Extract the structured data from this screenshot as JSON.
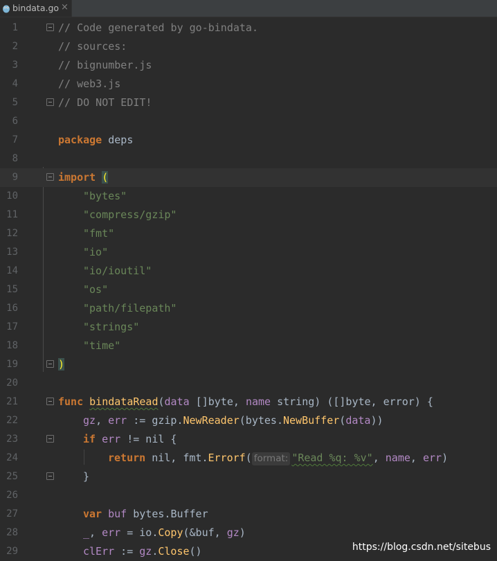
{
  "tab": {
    "filename": "bindata.go",
    "close_glyph": "×",
    "icon": "go-file-icon"
  },
  "lines": [
    {
      "n": "1"
    },
    {
      "n": "2"
    },
    {
      "n": "3"
    },
    {
      "n": "4"
    },
    {
      "n": "5"
    },
    {
      "n": "6"
    },
    {
      "n": "7"
    },
    {
      "n": "8"
    },
    {
      "n": "9"
    },
    {
      "n": "10"
    },
    {
      "n": "11"
    },
    {
      "n": "12"
    },
    {
      "n": "13"
    },
    {
      "n": "14"
    },
    {
      "n": "15"
    },
    {
      "n": "16"
    },
    {
      "n": "17"
    },
    {
      "n": "18"
    },
    {
      "n": "19"
    },
    {
      "n": "20"
    },
    {
      "n": "21"
    },
    {
      "n": "22"
    },
    {
      "n": "23"
    },
    {
      "n": "24"
    },
    {
      "n": "25"
    },
    {
      "n": "26"
    },
    {
      "n": "27"
    },
    {
      "n": "28"
    },
    {
      "n": "29"
    }
  ],
  "code": {
    "l1": "// Code generated by go-bindata.",
    "l2": "// sources:",
    "l3": "// bignumber.js",
    "l4": "// web3.js",
    "l5": "// DO NOT EDIT!",
    "l7_kw": "package",
    "l7_rest": " deps",
    "l9_kw": "import",
    "l9_paren": "(",
    "imports": [
      "\"bytes\"",
      "\"compress/gzip\"",
      "\"fmt\"",
      "\"io\"",
      "\"io/ioutil\"",
      "\"os\"",
      "\"path/filepath\"",
      "\"strings\"",
      "\"time\""
    ],
    "l19_paren": ")",
    "l21": {
      "kw": "func",
      "name": "bindataRead",
      "p_open": "(",
      "data": "data",
      "t1": " []byte, ",
      "name_p": "name",
      "t2": " string) ([]byte, ",
      "err": "error",
      "tail": ") {"
    },
    "l22": {
      "gz": "gz",
      "c1": ", ",
      "err": "err",
      "c2": " := gzip.",
      "fn1": "NewReader",
      "c3": "(bytes.",
      "fn2": "NewBuffer",
      "c4": "(",
      "data": "data",
      "c5": "))"
    },
    "l23": {
      "kw": "if",
      "err": "err",
      "rest": " != nil {"
    },
    "l24": {
      "kw": "return",
      "c1": " nil, fmt.",
      "fn": "Errorf",
      "c2": "(",
      "hint": "format:",
      "str": "\"Read %q: %v\"",
      "c3": ", ",
      "name": "name",
      "c4": ", ",
      "err": "err",
      "c5": ")"
    },
    "l25": "}",
    "l27": {
      "kw": "var",
      "buf": "buf",
      "rest": " bytes.",
      "typ": "Buffer"
    },
    "l28": {
      "u": "_",
      "c1": ", ",
      "err": "err",
      "c2": " = io.",
      "fn": "Copy",
      "c3": "(&buf, ",
      "gz": "gz",
      "c4": ")"
    },
    "l29": {
      "v": "clErr",
      "c1": " := ",
      "gz": "gz",
      "c2": ".",
      "fn": "Close",
      "c3": "()"
    }
  },
  "watermark": "https://blog.csdn.net/sitebus",
  "colors": {
    "background": "#2b2b2b",
    "keyword": "#cc7832",
    "string": "#6a8759",
    "comment": "#808080",
    "function": "#ffc66d",
    "parameter": "#b389c5"
  }
}
